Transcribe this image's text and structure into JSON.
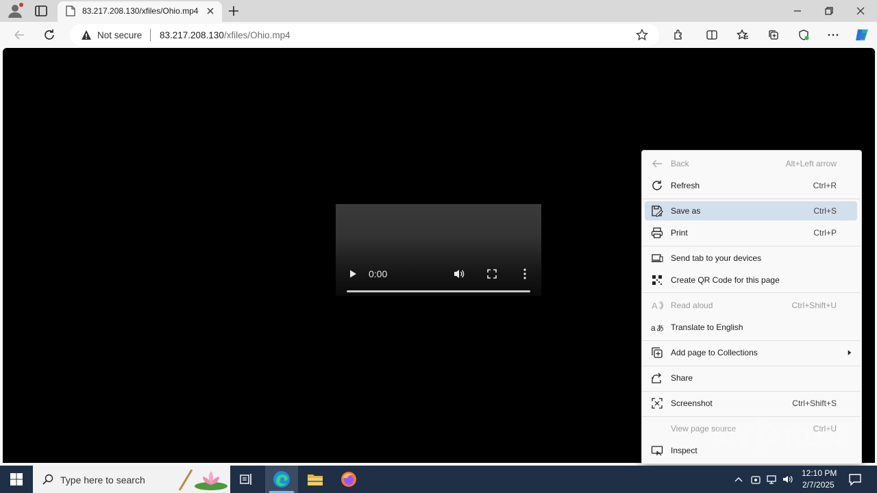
{
  "browser": {
    "tab_title": "83.217.208.130/xfiles/Ohio.mp4",
    "security_label": "Not secure",
    "url_host": "83.217.208.130",
    "url_path": "/xfiles/Ohio.mp4"
  },
  "video": {
    "time": "0:00",
    "progress": 0
  },
  "context_menu": {
    "items": [
      {
        "label": "Back",
        "shortcut": "Alt+Left arrow",
        "icon": "back-arrow-icon",
        "disabled": true
      },
      {
        "label": "Refresh",
        "shortcut": "Ctrl+R",
        "icon": "refresh-icon"
      },
      {
        "label": "Save as",
        "shortcut": "Ctrl+S",
        "icon": "save-as-icon",
        "highlighted": true
      },
      {
        "label": "Print",
        "shortcut": "Ctrl+P",
        "icon": "printer-icon"
      },
      {
        "label": "Send tab to your devices",
        "shortcut": "",
        "icon": "devices-icon"
      },
      {
        "label": "Create QR Code for this page",
        "shortcut": "",
        "icon": "qr-code-icon"
      },
      {
        "label": "Read aloud",
        "shortcut": "Ctrl+Shift+U",
        "icon": "read-aloud-icon",
        "disabled": true
      },
      {
        "label": "Translate to English",
        "shortcut": "",
        "icon": "translate-icon"
      },
      {
        "label": "Add page to Collections",
        "shortcut": "",
        "icon": "collections-icon",
        "submenu": true
      },
      {
        "label": "Share",
        "shortcut": "",
        "icon": "share-icon"
      },
      {
        "label": "Screenshot",
        "shortcut": "Ctrl+Shift+S",
        "icon": "screenshot-icon"
      },
      {
        "label": "View page source",
        "shortcut": "Ctrl+U",
        "icon": "",
        "disabled": true
      },
      {
        "label": "Inspect",
        "shortcut": "",
        "icon": "inspect-icon"
      }
    ]
  },
  "taskbar": {
    "search_placeholder": "Type here to search",
    "time": "12:10 PM",
    "date": "2/7/2025"
  },
  "colors": {
    "menu_highlight": "#d2dfec",
    "taskbar": "#1f2f45",
    "page_background": "#000000"
  }
}
